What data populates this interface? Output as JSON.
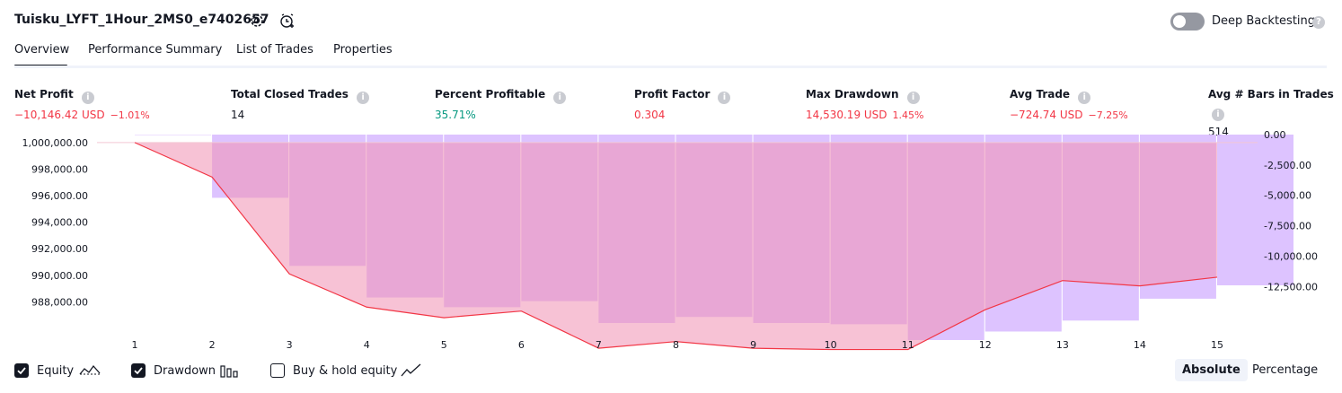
{
  "header": {
    "strategy_name": "Tuisku_LYFT_1Hour_2MS0_e7402657",
    "deep_backtesting_label": "Deep Backtesting",
    "deep_backtesting_enabled": false
  },
  "tabs": [
    "Overview",
    "Performance Summary",
    "List of Trades",
    "Properties"
  ],
  "active_tab": "Overview",
  "metrics": {
    "net_profit": {
      "label": "Net Profit",
      "value": "−10,146.42 USD",
      "pct": "−1.01%"
    },
    "total_closed_trades": {
      "label": "Total Closed Trades",
      "value": "14"
    },
    "percent_profitable": {
      "label": "Percent Profitable",
      "value": "35.71%"
    },
    "profit_factor": {
      "label": "Profit Factor",
      "value": "0.304"
    },
    "max_drawdown": {
      "label": "Max Drawdown",
      "value": "14,530.19 USD",
      "pct": "1.45%"
    },
    "avg_trade": {
      "label": "Avg Trade",
      "value": "−724.74 USD",
      "pct": "−7.25%"
    },
    "avg_bars": {
      "label": "Avg # Bars in Trades",
      "value": "514"
    }
  },
  "chart_data": {
    "type": "line",
    "x": [
      1,
      2,
      3,
      4,
      5,
      6,
      7,
      8,
      9,
      10,
      11,
      12,
      13,
      14,
      15
    ],
    "categories": [
      "1",
      "2",
      "3",
      "4",
      "5",
      "6",
      "7",
      "8",
      "9",
      "10",
      "11",
      "12",
      "13",
      "14",
      "15"
    ],
    "series": [
      {
        "name": "Equity",
        "type": "line",
        "color": "#f23645",
        "values": [
          1000000,
          997400,
          990100,
          987600,
          986800,
          987300,
          984500,
          985000,
          984500,
          984400,
          984400,
          987400,
          989600,
          989200,
          989854
        ]
      },
      {
        "name": "Drawdown",
        "type": "bar",
        "color": "#d1b3ff",
        "values": [
          0,
          -5200,
          -10800,
          -13400,
          -14200,
          -13700,
          -15500,
          -15000,
          -15500,
          -15600,
          -16900,
          -16200,
          -15300,
          -13500,
          -12400
        ]
      }
    ],
    "left_axis": {
      "ylim": [
        986400,
        1000600
      ],
      "ticks": [
        "1,000,000.00",
        "998,000.00",
        "996,000.00",
        "994,000.00",
        "992,000.00",
        "990,000.00",
        "988,000.00"
      ]
    },
    "right_axis": {
      "ylim": [
        -15500,
        0
      ],
      "ticks": [
        "0.00",
        "-2,500.00",
        "-5,000.00",
        "-7,500.00",
        "-10,000.00",
        "-12,500.00"
      ]
    }
  },
  "legend": {
    "items": [
      {
        "label": "Equity",
        "checked": true,
        "icon": "equity-line-icon"
      },
      {
        "label": "Drawdown",
        "checked": true,
        "icon": "drawdown-bars-icon"
      },
      {
        "label": "Buy & hold equity",
        "checked": false,
        "icon": "buy-hold-line-icon"
      }
    ]
  },
  "view_mode": {
    "options": [
      "Absolute",
      "Percentage"
    ],
    "selected": "Absolute"
  },
  "colors": {
    "equity": "#f23645",
    "drawdown": "#d1b3ff",
    "equity_fill": "#f4a3b9",
    "positive": "#089981"
  }
}
